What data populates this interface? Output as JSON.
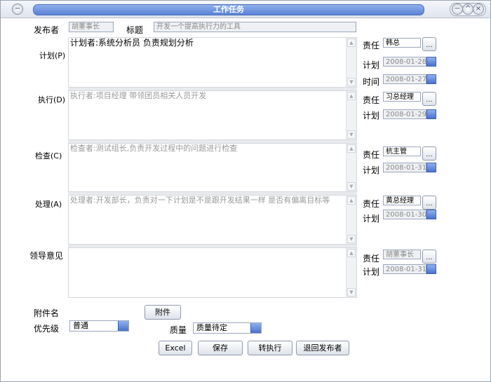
{
  "window": {
    "title": "工作任务"
  },
  "header": {
    "publisher_label": "发布者",
    "publisher_value": "胡董事长",
    "subject_label": "标题",
    "subject_value": "开发一个提高执行力的工具"
  },
  "plan": {
    "label": "计划(P)",
    "text": "计划者:系统分析员 负责规划分析",
    "resp_label": "责任",
    "resp_value": "韩总",
    "plan_label": "计划",
    "plan_date": "2008-01-28",
    "time_label": "时间",
    "time_date": "2008-01-27"
  },
  "do": {
    "label": "执行(D)",
    "text": "执行者:项目经理 带领团员相关人员开发",
    "resp_label": "责任",
    "resp_value": "习总经理",
    "plan_label": "计划",
    "plan_date": "2008-01-29"
  },
  "check": {
    "label": "检查(C)",
    "text": "检查者:测试组长,负责开发过程中的问题进行检查",
    "resp_label": "责任",
    "resp_value": "杭主管",
    "plan_label": "计划",
    "plan_date": "2008-01-31"
  },
  "act": {
    "label": "处理(A)",
    "text": "处理者:开发部长，负责对一下计划是不是跟开发结果一样 是否有偏离目标等",
    "resp_label": "责任",
    "resp_value": "黄总经理",
    "plan_label": "计划",
    "plan_date": "2008-01-30"
  },
  "leader": {
    "label": "领导意见",
    "text": "",
    "resp_label": "责任",
    "resp_value": "胡董事长",
    "plan_label": "计划",
    "plan_date": "2008-01-31"
  },
  "footer": {
    "attachment_label": "附件名",
    "attachment_button": "附件",
    "priority_label": "优先级",
    "priority_value": "普通",
    "quality_label": "质量",
    "quality_value": "质量待定"
  },
  "actions": {
    "excel": "Excel",
    "save": "保存",
    "execute": "转执行",
    "return": "退回发布者"
  },
  "icons": {
    "scroll_up": "▲",
    "scroll_down": "▼",
    "browse": "...",
    "title_icon": "−",
    "minimize": "−",
    "maximize": "^",
    "close": "×"
  }
}
